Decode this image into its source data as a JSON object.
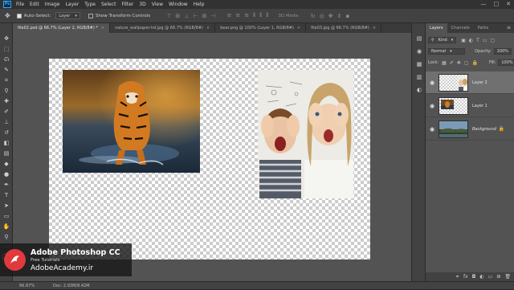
{
  "app": {
    "logo_text": "Ps",
    "menu": [
      "File",
      "Edit",
      "Image",
      "Layer",
      "Type",
      "Select",
      "Filter",
      "3D",
      "View",
      "Window",
      "Help"
    ],
    "window_controls": [
      "—",
      "□",
      "✕"
    ]
  },
  "options": {
    "auto_select_label": "Auto-Select:",
    "auto_select_target": "Layer",
    "show_transform_label": "Show Transform Controls",
    "mode_3d_label": "3D Mode:"
  },
  "tabs": [
    {
      "label": "file02.psd @ 66.7% (Layer 2, RGB/8#) *",
      "active": true
    },
    {
      "label": "nature_wallpaper-hd.jpg @ 66.7% (RGB/8#)",
      "active": false
    },
    {
      "label": "bear.png @ 100% (Layer 1, RGB/8#)",
      "active": false
    },
    {
      "label": "file03.jpg @ 66.7% (RGB/8#)",
      "active": false
    }
  ],
  "status": {
    "zoom": "66.67%",
    "doc_size": "Doc: 2.93M/8.42M"
  },
  "brand": {
    "title": "Adobe Photoshop CC",
    "subtitle": "Free Tutorials",
    "site": "AdobeAcademy.ir"
  },
  "layers_panel": {
    "tabs": [
      {
        "label": "Layers",
        "active": true
      },
      {
        "label": "Channels",
        "active": false
      },
      {
        "label": "Paths",
        "active": false
      }
    ],
    "kind_filter": "Kind",
    "blend_mode": "Normal",
    "opacity_label": "Opacity:",
    "opacity_value": "100%",
    "lock_label": "Lock:",
    "fill_label": "Fill:",
    "fill_value": "100%",
    "layers": [
      {
        "name": "Layer 2",
        "visible": true,
        "selected": true,
        "thumb": "kids"
      },
      {
        "name": "Layer 1",
        "visible": true,
        "selected": false,
        "thumb": "tiger"
      },
      {
        "name": "Background",
        "visible": true,
        "selected": false,
        "thumb": "landscape",
        "locked": true
      }
    ]
  },
  "colors": {
    "accent": "#31a8ff",
    "brand_red": "#e03a3e",
    "selected_layer": "#707070"
  }
}
